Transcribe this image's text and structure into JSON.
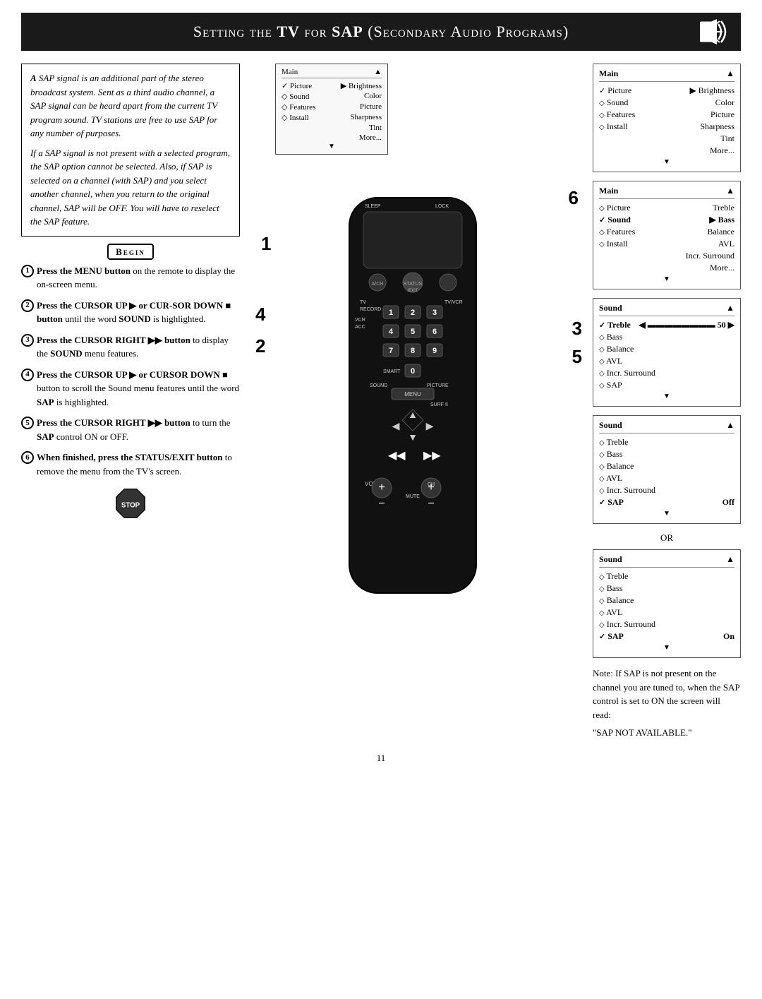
{
  "header": {
    "title_prefix": "Setting the ",
    "title_bold1": "TV",
    "title_mid": " for ",
    "title_bold2": "SAP",
    "title_suffix": " (Secondary Audio Programs)"
  },
  "intro": {
    "para1": "SAP signal is an additional part of the stereo broadcast system. Sent as a third audio channel, a SAP signal can be heard apart from the current TV program sound. TV stations are free to use SAP for any number of purposes.",
    "para2": "If a SAP signal is not present with a selected program, the SAP option cannot be selected. Also, if SAP is selected on a channel (with SAP) and you select another channel, when you return to the original channel, SAP will be OFF. You will have to reselect the SAP feature."
  },
  "begin_label": "Begin",
  "steps": [
    {
      "num": "1",
      "text": "Press the MENU button on the remote to display the on-screen menu."
    },
    {
      "num": "2",
      "text": "Press the CURSOR UP ▶ or CURSOR DOWN ■ button until the word SOUND is highlighted."
    },
    {
      "num": "3",
      "text": "Press the CURSOR RIGHT ▶▶ button to display the SOUND menu features."
    },
    {
      "num": "4",
      "text": "Press the CURSOR UP ▶ or CURSOR DOWN ■ button to scroll the Sound menu features until the word SAP is highlighted."
    },
    {
      "num": "5",
      "text": "Press the CURSOR RIGHT ▶▶ button to turn the SAP control ON or OFF."
    },
    {
      "num": "6",
      "text": "When finished, press the STATUS/EXIT button to remove the menu from the TV's screen."
    }
  ],
  "stop_label": "Stop",
  "menu_main": {
    "title": "Main",
    "items": [
      {
        "icon": "check",
        "label": "Picture",
        "arrow": true,
        "sub": "Brightness"
      },
      {
        "icon": "diamond",
        "label": "Sound",
        "arrow": false,
        "sub": "Color"
      },
      {
        "icon": "diamond",
        "label": "Features",
        "arrow": false,
        "sub": "Picture"
      },
      {
        "icon": "diamond",
        "label": "Install",
        "arrow": false,
        "sub": "Sharpness"
      },
      {
        "sub2": "Tint"
      },
      {
        "sub2": "More..."
      }
    ]
  },
  "menu_main2": {
    "title": "Main",
    "items": [
      {
        "icon": "diamond",
        "label": "Picture",
        "value": "Treble"
      },
      {
        "icon": "check",
        "label": "Sound",
        "arrow": true,
        "value": "Bass"
      },
      {
        "icon": "diamond",
        "label": "Features",
        "value": "Balance"
      },
      {
        "icon": "diamond",
        "label": "Install",
        "value": "AVL"
      },
      {
        "value2": "Incr. Surround"
      },
      {
        "value2": "More..."
      }
    ]
  },
  "menu_sound1": {
    "title": "Sound",
    "items": [
      {
        "icon": "check",
        "label": "Treble",
        "bar": "50"
      },
      {
        "icon": "diamond",
        "label": "Bass"
      },
      {
        "icon": "diamond",
        "label": "Balance"
      },
      {
        "icon": "diamond",
        "label": "AVL"
      },
      {
        "icon": "diamond",
        "label": "Incr. Surround"
      },
      {
        "icon": "diamond",
        "label": "SAP"
      }
    ]
  },
  "menu_sound2": {
    "title": "Sound",
    "items": [
      {
        "icon": "diamond",
        "label": "Treble"
      },
      {
        "icon": "diamond",
        "label": "Bass"
      },
      {
        "icon": "diamond",
        "label": "Balance"
      },
      {
        "icon": "diamond",
        "label": "AVL"
      },
      {
        "icon": "diamond",
        "label": "Incr. Surround"
      },
      {
        "icon": "check",
        "label": "SAP",
        "value": "Off"
      }
    ]
  },
  "menu_sound3": {
    "title": "Sound",
    "items": [
      {
        "icon": "diamond",
        "label": "Treble"
      },
      {
        "icon": "diamond",
        "label": "Bass"
      },
      {
        "icon": "diamond",
        "label": "Balance"
      },
      {
        "icon": "diamond",
        "label": "AVL"
      },
      {
        "icon": "diamond",
        "label": "Incr. Surround"
      },
      {
        "icon": "check",
        "label": "SAP",
        "value": "On"
      }
    ]
  },
  "or_label": "OR",
  "note": {
    "text": "Note: If SAP is not present on the channel you are tuned to, when the SAP control is set to ON the screen will read:\n\"SAP NOT AVAILABLE.\""
  },
  "page_number": "11"
}
